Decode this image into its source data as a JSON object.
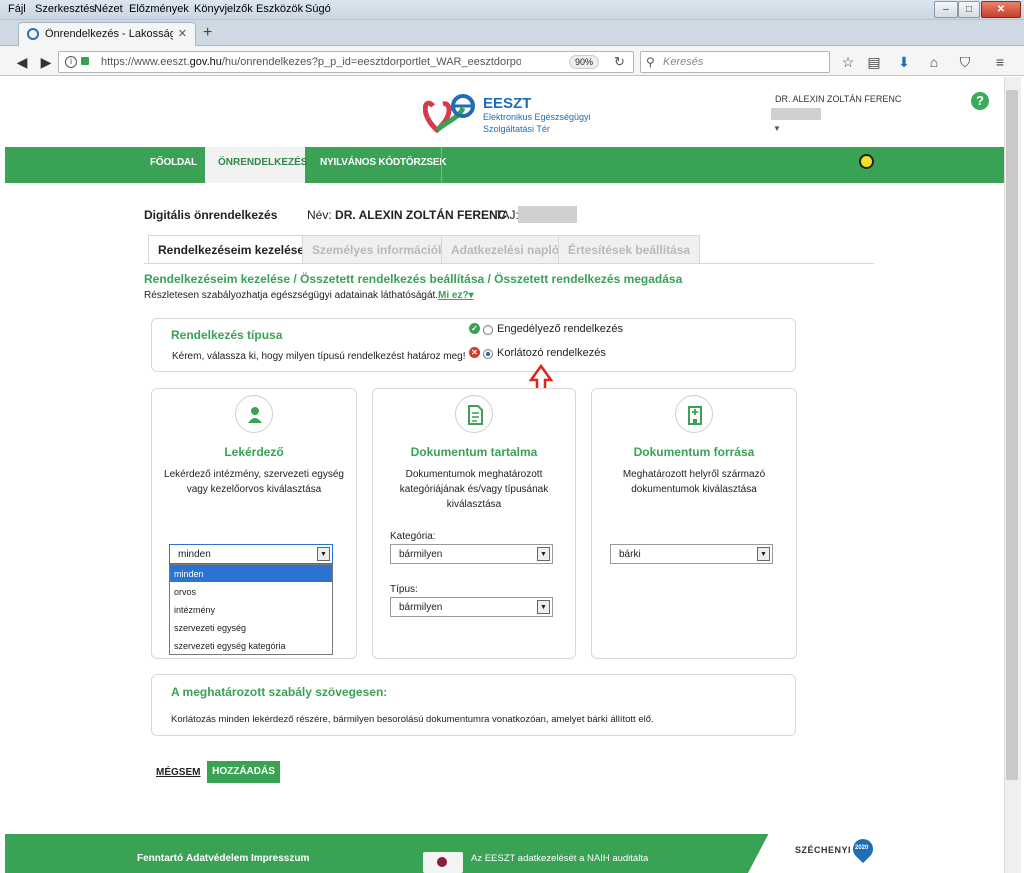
{
  "menu": [
    "Fájl",
    "Szerkesztés",
    "Nézet",
    "Előzmények",
    "Könyvjelzők",
    "Eszközök",
    "Súgó"
  ],
  "browser": {
    "tab_title": "Önrendelkezés - Lakossági Po",
    "url_prefix": "https://www.eeszt.",
    "url_domain": "gov.hu",
    "url_suffix": "/hu/onrendelkezes?p_p_id=eesztdorportlet_WAR_eesztdorportlet&p_p_lifec",
    "zoom": "90%",
    "search_placeholder": "Keresés"
  },
  "header": {
    "logo_title": "EESZT",
    "logo_line1": "Elektronikus Egészségügyi",
    "logo_line2": "Szolgáltatási Tér",
    "user_name": "DR. ALEXIN ZOLTÁN FERENC",
    "help": "?"
  },
  "nav": {
    "home": "FŐOLDAL",
    "self_determination": "ÖNRENDELKEZÉS",
    "codes": "NYILVÁNOS KÓDTÖRZSEK"
  },
  "profile": {
    "section_title": "Digitális önrendelkezés",
    "name_label": "Név:",
    "name_value": "DR. ALEXIN ZOLTÁN FERENC",
    "taj_label": "TAJ:"
  },
  "tabs": [
    "Rendelkezéseim kezelése",
    "Személyes információk",
    "Adatkezelési napló",
    "Értesítések beállítása"
  ],
  "breadcrumb": "Rendelkezéseim kezelése / Összetett rendelkezés beállítása / Összetett rendelkezés megadása",
  "subtitle": "Részletesen szabályozhatja egészségügyi adatainak láthatóságát.",
  "what_is": "Mi ez?",
  "type_panel": {
    "title": "Rendelkezés típusa",
    "desc": "Kérem, válassza ki, hogy milyen típusú rendelkezést határoz meg!",
    "option_allow": "Engedélyező rendelkezés",
    "option_restrict": "Korlátozó rendelkezés",
    "selected": "Korlátozó rendelkezés"
  },
  "cards": {
    "querier": {
      "title": "Lekérdező",
      "desc_line1": "Lekérdező intézmény, szervezeti egység",
      "desc_line2": "vagy kezelőorvos kiválasztása",
      "select_value": "minden",
      "options": [
        "minden",
        "orvos",
        "intézmény",
        "szervezeti egység",
        "szervezeti egység kategória"
      ]
    },
    "content": {
      "title": "Dokumentum tartalma",
      "desc_line1": "Dokumentumok meghatározott",
      "desc_line2": "kategóriájának és/vagy típusának",
      "desc_line3": "kiválasztása",
      "category_label": "Kategória:",
      "category_value": "bármilyen",
      "type_label": "Típus:",
      "type_value": "bármilyen"
    },
    "source": {
      "title": "Dokumentum forrása",
      "desc_line1": "Meghatározott helyről származó",
      "desc_line2": "dokumentumok kiválasztása",
      "select_value": "bárki"
    }
  },
  "rule": {
    "title": "A meghatározott szabály szövegesen:",
    "text": "Korlátozás minden lekérdező részére, bármilyen  besorolású dokumentumra vonatkozóan, amelyet bárki állított elő."
  },
  "actions": {
    "cancel": "MÉGSEM",
    "add": "HOZZÁADÁS"
  },
  "footer": {
    "maintainer": "Fenntartó",
    "privacy": "Adatvédelem",
    "imprint": "Impresszum",
    "naih": "Az EESZT adatkezelését a NAIH auditálta",
    "szechenyi": "SZÉCHENYI",
    "szechenyi_year": "2020"
  },
  "colors": {
    "brand_green": "#3aa255",
    "brand_blue": "#1f6db3",
    "highlight": "#2b73d2",
    "arrow_red": "#e0231b"
  }
}
